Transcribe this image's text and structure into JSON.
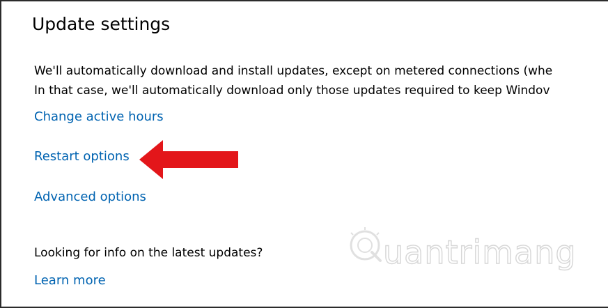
{
  "section": {
    "title": "Update settings",
    "description_line1": "We'll automatically download and install updates, except on metered connections (whe",
    "description_line2": "In that case, we'll automatically download only those updates required to keep Windov"
  },
  "links": {
    "change_active_hours": "Change active hours",
    "restart_options": "Restart options",
    "advanced_options": "Advanced options",
    "learn_more": "Learn more"
  },
  "info": {
    "question": "Looking for info on the latest updates?"
  },
  "annotation": {
    "arrow_icon": "red-arrow-left-icon",
    "arrow_color": "#e3161a"
  },
  "watermark": {
    "text": "uantrimang",
    "logo_icon": "quantrimang-logo-icon"
  },
  "colors": {
    "link": "#0063b1",
    "text": "#000000",
    "background": "#ffffff"
  }
}
